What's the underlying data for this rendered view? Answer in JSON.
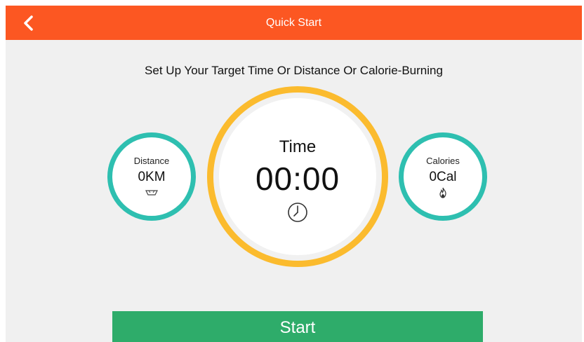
{
  "header": {
    "title": "Quick Start"
  },
  "subtitle": "Set Up Your Target Time Or Distance Or Calorie-Burning",
  "targets": {
    "distance": {
      "label": "Distance",
      "value": "0KM",
      "icon": "distance-gauge-icon"
    },
    "time": {
      "label": "Time",
      "value": "00:00",
      "icon": "clock-icon"
    },
    "calories": {
      "label": "Calories",
      "value": "0Cal",
      "icon": "flame-icon"
    }
  },
  "start_button": {
    "label": "Start"
  },
  "colors": {
    "header": "#fc5722",
    "accent_ring_small": "#2ebfb0",
    "accent_ring_time": "#fbbb2e",
    "start_button": "#2eac6a",
    "background": "#f0f0f0"
  }
}
